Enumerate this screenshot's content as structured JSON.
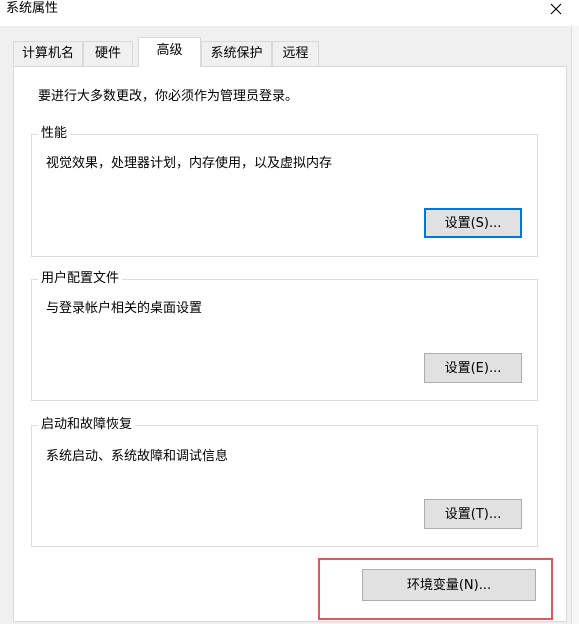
{
  "window": {
    "title": "系统属性",
    "close_icon": "close-icon"
  },
  "tabs": [
    {
      "label": "计算机名",
      "active": false
    },
    {
      "label": "硬件",
      "active": false
    },
    {
      "label": "高级",
      "active": true
    },
    {
      "label": "系统保护",
      "active": false
    },
    {
      "label": "远程",
      "active": false
    }
  ],
  "advanced": {
    "admin_note": "要进行大多数更改，你必须作为管理员登录。",
    "performance": {
      "title": "性能",
      "description": "视觉效果，处理器计划，内存使用，以及虚拟内存",
      "button_label": "设置(S)..."
    },
    "user_profiles": {
      "title": "用户配置文件",
      "description": "与登录帐户相关的桌面设置",
      "button_label": "设置(E)..."
    },
    "startup_recovery": {
      "title": "启动和故障恢复",
      "description": "系统启动、系统故障和调试信息",
      "button_label": "设置(T)..."
    },
    "env_button_label": "环境变量(N)..."
  },
  "colors": {
    "highlight": "#e0575f",
    "default_button_border": "#0078d7"
  }
}
